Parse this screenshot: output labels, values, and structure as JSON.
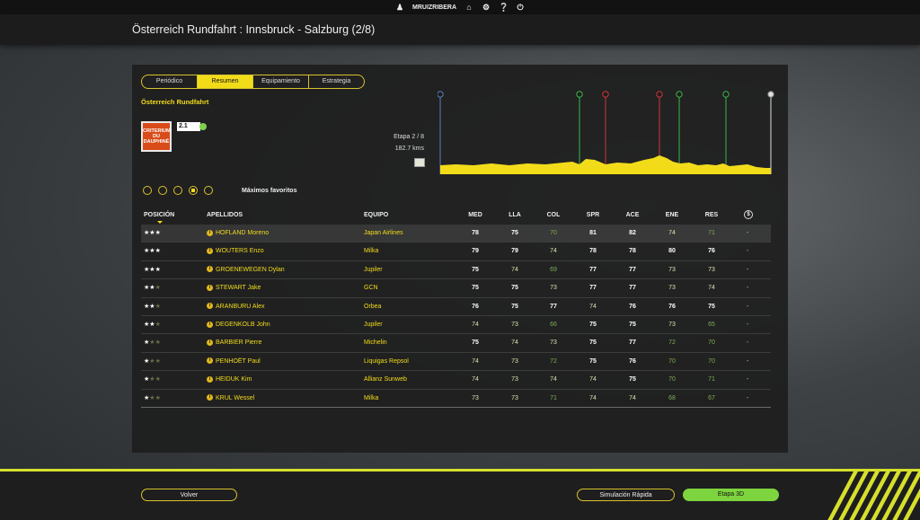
{
  "topbar": {
    "username": "MRUIZRIBERA",
    "icons": [
      "users-icon",
      "home-icon",
      "gear-icon",
      "help-icon",
      "power-icon"
    ]
  },
  "header": {
    "title": "Österreich Rundfahrt : Innsbruck - Salzburg (2/8)"
  },
  "tabs": [
    {
      "label": "Periódico",
      "active": false
    },
    {
      "label": "Resumen",
      "active": true
    },
    {
      "label": "Equipamiento",
      "active": false
    },
    {
      "label": "Estrategia",
      "active": false
    }
  ],
  "race": {
    "name": "Österreich Rundfahrt",
    "logo_text": "CRITERIUM DU DAUPHINÉ",
    "category": "2.1",
    "stage": "Etapa 2 / 8",
    "distance": "182.7 kms"
  },
  "profile_markers": [
    "start",
    "sprint",
    "climb",
    "climb",
    "sprint",
    "sprint",
    "finish"
  ],
  "filter": {
    "label": "Máximos favoritos",
    "options_count": 5,
    "selected_index": 3
  },
  "table": {
    "headers": {
      "pos": "POSICIÓN",
      "name": "APELLIDOS",
      "team": "EQUIPO",
      "med": "MED",
      "lla": "LLA",
      "col": "COL",
      "spr": "SPR",
      "ace": "ACE",
      "ene": "ENE",
      "res": "RES"
    },
    "rows": [
      {
        "stars": 3,
        "name": "HOFLAND Moreno",
        "team": "Japan Airlines",
        "med": "78",
        "lla": "75",
        "col": "70",
        "spr": "81",
        "ace": "82",
        "ene": "74",
        "res": "71",
        "money": "-"
      },
      {
        "stars": 3,
        "name": "WOUTERS Enzo",
        "team": "Milka",
        "med": "79",
        "lla": "79",
        "col": "74",
        "spr": "78",
        "ace": "78",
        "ene": "80",
        "res": "76",
        "money": "-"
      },
      {
        "stars": 3,
        "name": "GROENEWEGEN Dylan",
        "team": "Jupiler",
        "med": "75",
        "lla": "74",
        "col": "69",
        "spr": "77",
        "ace": "77",
        "ene": "73",
        "res": "73",
        "money": "-"
      },
      {
        "stars": 2,
        "name": "STEWART Jake",
        "team": "GCN",
        "med": "75",
        "lla": "75",
        "col": "73",
        "spr": "77",
        "ace": "77",
        "ene": "73",
        "res": "74",
        "money": "-"
      },
      {
        "stars": 2,
        "name": "ARANBURU Alex",
        "team": "Orbea",
        "med": "76",
        "lla": "75",
        "col": "77",
        "spr": "74",
        "ace": "76",
        "ene": "76",
        "res": "75",
        "money": "-"
      },
      {
        "stars": 2,
        "name": "DEGENKOLB John",
        "team": "Jupiler",
        "med": "74",
        "lla": "73",
        "col": "66",
        "spr": "75",
        "ace": "75",
        "ene": "73",
        "res": "65",
        "money": "-"
      },
      {
        "stars": 1,
        "name": "BARBIER Pierre",
        "team": "Michelin",
        "med": "75",
        "lla": "74",
        "col": "73",
        "spr": "75",
        "ace": "77",
        "ene": "72",
        "res": "70",
        "money": "-"
      },
      {
        "stars": 1,
        "name": "PENHOËT Paul",
        "team": "Liquigas Repsol",
        "med": "74",
        "lla": "73",
        "col": "72",
        "spr": "75",
        "ace": "76",
        "ene": "70",
        "res": "70",
        "money": "-"
      },
      {
        "stars": 1,
        "name": "HEIDUK Kim",
        "team": "Allianz Sunweb",
        "med": "74",
        "lla": "73",
        "col": "74",
        "spr": "74",
        "ace": "75",
        "ene": "70",
        "res": "71",
        "money": "-"
      },
      {
        "stars": 1,
        "name": "KRUL Wessel",
        "team": "Milka",
        "med": "73",
        "lla": "73",
        "col": "71",
        "spr": "74",
        "ace": "74",
        "ene": "68",
        "res": "67",
        "money": "-"
      }
    ]
  },
  "buttons": {
    "back": "Volver",
    "quick_sim": "Simulación Rápida",
    "stage3d": "Etapa 3D"
  },
  "colors": {
    "accent": "#f2dc1a",
    "green": "#7ed43e",
    "lime": "#d6e02c"
  }
}
